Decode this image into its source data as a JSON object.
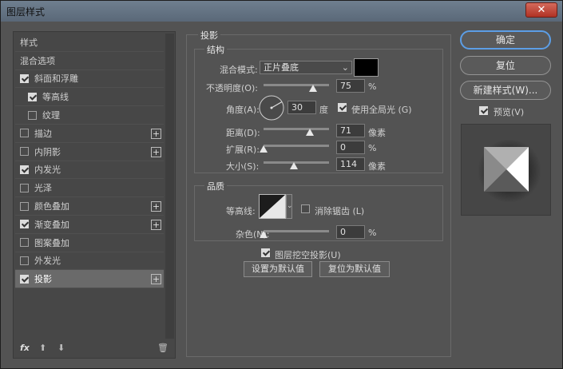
{
  "window": {
    "title": "图层样式",
    "close": "✕"
  },
  "styles_list": {
    "items": [
      {
        "label": "样式",
        "checkbox": false,
        "checked": false,
        "plus": false,
        "indent": 0
      },
      {
        "label": "混合选项",
        "checkbox": false,
        "checked": false,
        "plus": false,
        "indent": 0
      },
      {
        "label": "斜面和浮雕",
        "checkbox": true,
        "checked": true,
        "plus": false,
        "indent": 0
      },
      {
        "label": "等高线",
        "checkbox": true,
        "checked": true,
        "plus": false,
        "indent": 1
      },
      {
        "label": "纹理",
        "checkbox": true,
        "checked": false,
        "plus": false,
        "indent": 1
      },
      {
        "label": "描边",
        "checkbox": true,
        "checked": false,
        "plus": true,
        "indent": 0
      },
      {
        "label": "内阴影",
        "checkbox": true,
        "checked": false,
        "plus": true,
        "indent": 0
      },
      {
        "label": "内发光",
        "checkbox": true,
        "checked": true,
        "plus": false,
        "indent": 0
      },
      {
        "label": "光泽",
        "checkbox": true,
        "checked": false,
        "plus": false,
        "indent": 0
      },
      {
        "label": "颜色叠加",
        "checkbox": true,
        "checked": false,
        "plus": true,
        "indent": 0
      },
      {
        "label": "渐变叠加",
        "checkbox": true,
        "checked": true,
        "plus": true,
        "indent": 0
      },
      {
        "label": "图案叠加",
        "checkbox": true,
        "checked": false,
        "plus": false,
        "indent": 0
      },
      {
        "label": "外发光",
        "checkbox": true,
        "checked": false,
        "plus": false,
        "indent": 0
      },
      {
        "label": "投影",
        "checkbox": true,
        "checked": true,
        "plus": true,
        "indent": 0,
        "selected": true
      }
    ],
    "footer": {
      "fx": "fx",
      "up": "⬆",
      "down": "⬇",
      "trash": "🗑"
    }
  },
  "drop_shadow": {
    "title": "投影",
    "structure": {
      "title": "结构",
      "blend_mode_label": "混合模式:",
      "blend_mode_value": "正片叠底",
      "color": "#000000",
      "opacity_label": "不透明度(O):",
      "opacity": "75",
      "opacity_pct": 0.75,
      "angle_label": "角度(A):",
      "angle": "30",
      "angle_unit": "度",
      "global_light_label": "使用全局光 (G)",
      "global_light": true,
      "distance_label": "距离(D):",
      "distance": "71",
      "distance_pct": 0.71,
      "spread_label": "扩展(R):",
      "spread": "0",
      "spread_pct": 0,
      "size_label": "大小(S):",
      "size": "114",
      "size_pct": 0.46,
      "px_unit": "像素",
      "pct_unit": "%"
    },
    "quality": {
      "title": "品质",
      "contour_label": "等高线:",
      "antialias_label": "消除锯齿 (L)",
      "antialias": false,
      "noise_label": "杂色(N):",
      "noise": "0",
      "noise_pct": 0,
      "pct_unit": "%"
    },
    "knockout_label": "图层挖空投影(U)",
    "knockout": true,
    "set_default": "设置为默认值",
    "reset_default": "复位为默认值"
  },
  "buttons": {
    "ok": "确定",
    "reset": "复位",
    "new_style": "新建样式(W)...",
    "preview_label": "预览(V)",
    "preview": true
  }
}
